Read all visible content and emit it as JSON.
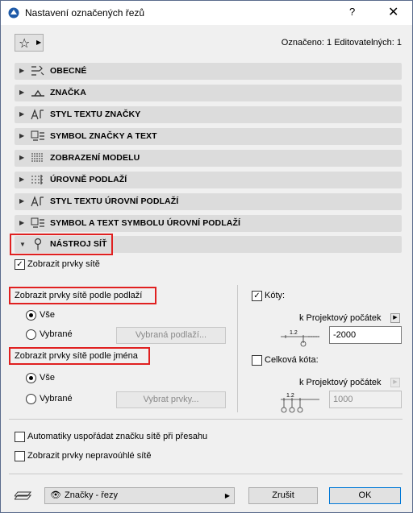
{
  "window": {
    "title": "Nastavení označených řezů",
    "help": "?",
    "close": "✕"
  },
  "header": {
    "selected_info": "Označeno: 1 Editovatelných: 1"
  },
  "panels": [
    {
      "label": "OBECNÉ",
      "icon": "general-settings-icon"
    },
    {
      "label": "ZNAČKA",
      "icon": "marker-icon"
    },
    {
      "label": "STYL TEXTU ZNAČKY",
      "icon": "text-style-icon"
    },
    {
      "label": "SYMBOL ZNAČKY A TEXT",
      "icon": "symbol-text-icon"
    },
    {
      "label": "ZOBRAZENÍ MODELU",
      "icon": "model-display-icon"
    },
    {
      "label": "ÚROVNĚ PODLAŽÍ",
      "icon": "story-levels-icon"
    },
    {
      "label": "STYL TEXTU ÚROVNÍ PODLAŽÍ",
      "icon": "text-style-icon"
    },
    {
      "label": "SYMBOL A TEXT SYMBOLU ÚROVNÍ PODLAŽÍ",
      "icon": "symbol-text-icon"
    },
    {
      "label": "NÁSTROJ SÍŤ",
      "icon": "grid-tool-icon"
    }
  ],
  "grid": {
    "show_grid_elements": "Zobrazit prvky sítě",
    "by_story_title": "Zobrazit prvky sítě podle podlaží",
    "all": "Vše",
    "selected": "Vybrané",
    "selected_stories_btn": "Vybraná podlaží...",
    "by_name_title": "Zobrazit prvky sítě podle jména",
    "select_elements_btn": "Vybrat prvky...",
    "dimensions": "Kóty:",
    "ref_project_origin": "k Projektový počátek",
    "dim_value": "-2000",
    "overall_dim": "Celková kóta:",
    "overall_value": "1000",
    "auto_arrange": "Automatiky uspořádat značku sítě při přesahu",
    "show_nonortho": "Zobrazit prvky nepravoúhlé sítě"
  },
  "footer": {
    "layer_combo": "Značky - řezy",
    "cancel": "Zrušit",
    "ok": "OK"
  }
}
